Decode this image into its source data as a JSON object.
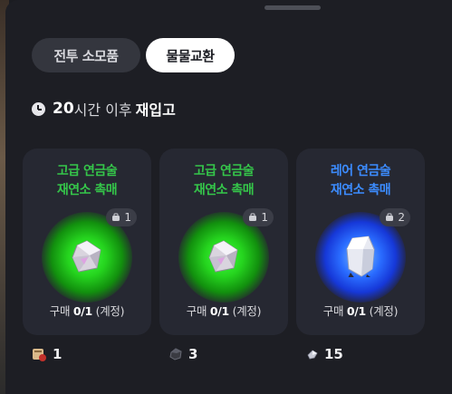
{
  "tabs": [
    {
      "label": "전투 소모품",
      "active": false
    },
    {
      "label": "물물교환",
      "active": true
    }
  ],
  "restock": {
    "hours": "20",
    "middle": "시간 이후",
    "suffix": "재입고"
  },
  "cards": [
    {
      "title_line1": "고급 연금술",
      "title_line2": "재연소 촉매",
      "grade_color": "#35c64a",
      "owned": "1",
      "limit_prefix": "구매",
      "limit_value": "0/1",
      "limit_suffix": "(계정)",
      "cost_icon": "scroll-pouch-icon",
      "cost": "1"
    },
    {
      "title_line1": "고급 연금술",
      "title_line2": "재연소 촉매",
      "grade_color": "#35c64a",
      "owned": "1",
      "limit_prefix": "구매",
      "limit_value": "0/1",
      "limit_suffix": "(계정)",
      "cost_icon": "ore-icon",
      "cost": "3"
    },
    {
      "title_line1": "레어 연금술",
      "title_line2": "재연소 촉매",
      "grade_color": "#3c8cff",
      "owned": "2",
      "limit_prefix": "구매",
      "limit_value": "0/1",
      "limit_suffix": "(계정)",
      "cost_icon": "crystal-shard-icon",
      "cost": "15"
    }
  ]
}
